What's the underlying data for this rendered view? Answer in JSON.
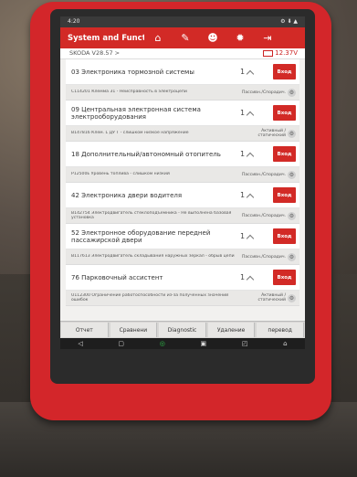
{
  "statusbar": {
    "time": "4:20",
    "icons": "⚙ ⬇ ▲"
  },
  "appbar": {
    "title": "System and Function",
    "icons": [
      "home-icon",
      "report-icon",
      "user-icon",
      "settings-icon",
      "exit-icon"
    ]
  },
  "vehicle": {
    "model": "SKODA V28.57 >",
    "voltage": "12.37V"
  },
  "ecus": [
    {
      "name": "03 Электроника тормозной системы",
      "count": "1",
      "button": "Вход",
      "dtc": "C114201 Клемма 31 - Неисправность в электроцепи",
      "status": "Пассивн./Спорадич."
    },
    {
      "name": "09 Центральная электронная система электрооборудования",
      "count": "1",
      "button": "Вход",
      "dtc": "B147816 Клем. L ДУ Т - слишком низкое напряжение",
      "status": "Активный /статический"
    },
    {
      "name": "18 Дополнительный/автономный отопитель",
      "count": "1",
      "button": "Вход",
      "dtc": "P12500E Уровень топлива - слишком низкий",
      "status": "Пассивн./Спорадич."
    },
    {
      "name": "42 Электроника двери водителя",
      "count": "1",
      "button": "Вход",
      "dtc": "B142754 Электродвигатель стеклоподъёмника - Не выполнена базовая установка",
      "status": "Пассивн./Спорадич."
    },
    {
      "name": "52 Электронное оборудование передней пассажирской двери",
      "count": "1",
      "button": "Вход",
      "dtc": "B117613 Электродвигатель складывания наружных зеркал - обрыв цепи",
      "status": "Пассивн./Спорадич."
    },
    {
      "name": "76 Парковочный ассистент",
      "count": "1",
      "button": "Вход",
      "dtc": "U112300 Ограничение работоспособности из-за полученных значений ошибок",
      "status": "Активный /статический"
    }
  ],
  "bottom_buttons": [
    "Отчет",
    "Сравнени",
    "Diagnostic",
    "Удаление",
    "перевод"
  ],
  "navbar": [
    "◁",
    "▢",
    "◎",
    "▣",
    "◰",
    "⌂"
  ]
}
